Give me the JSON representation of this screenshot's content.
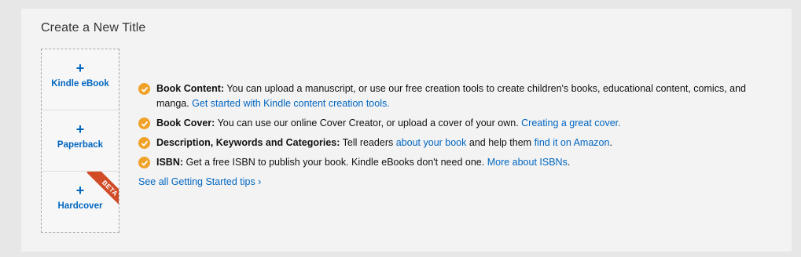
{
  "panel_title": "Create a New Title",
  "formats": [
    {
      "plus": "+",
      "label": "Kindle eBook"
    },
    {
      "plus": "+",
      "label": "Paperback"
    },
    {
      "plus": "+",
      "label": "Hardcover",
      "badge": "BETA"
    }
  ],
  "tips": [
    {
      "heading": "Book Content:",
      "text": " You can upload a manuscript, or use our free creation tools to create children's books, educational content, comics, and manga. ",
      "link": "Get started with Kindle content creation tools."
    },
    {
      "heading": "Book Cover:",
      "text": " You can use our online Cover Creator, or upload a cover of your own. ",
      "link": "Creating a great cover."
    },
    {
      "heading": "Description, Keywords and Categories:",
      "text": " Tell readers ",
      "link": "about your book",
      "text2": " and help them ",
      "link2": "find it on Amazon",
      "text3": "."
    },
    {
      "heading": "ISBN:",
      "text": " Get a free ISBN to publish your book. Kindle eBooks don't need one. ",
      "link": "More about ISBNs",
      "text2": "."
    }
  ],
  "see_all_link": "See all Getting Started tips ›",
  "colors": {
    "link": "#0066c0",
    "check": "#f0a128",
    "beta_ribbon": "#d14b27"
  }
}
